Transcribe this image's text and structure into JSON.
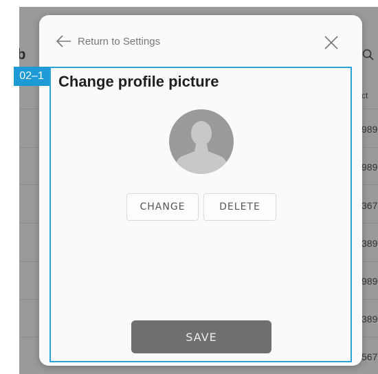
{
  "background": {
    "title_fragment": "mb",
    "column_header_fragment": "ct",
    "row_fragments": [
      "989",
      "989",
      "367",
      "389",
      "989",
      "389",
      "567"
    ]
  },
  "modal": {
    "back_label": "Return to Settings",
    "title": "Change profile picture",
    "change_label": "CHANGE",
    "delete_label": "DELETE",
    "save_label": "SAVE"
  },
  "annotation": {
    "tag": "02–1",
    "color": "#1e9ad6"
  },
  "icons": {
    "back": "arrow-left-icon",
    "close": "close-icon",
    "search": "search-icon",
    "avatar": "user-avatar-icon"
  }
}
